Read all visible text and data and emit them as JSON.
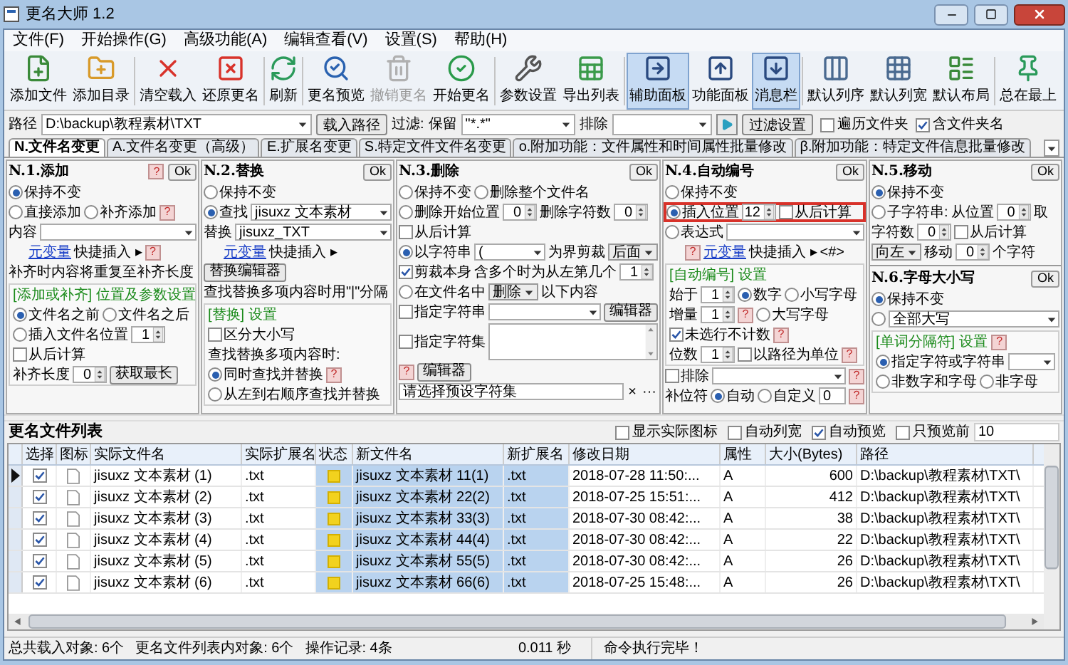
{
  "window": {
    "title": "更名大师 1.2"
  },
  "menu": [
    "文件(F)",
    "开始操作(G)",
    "高级功能(A)",
    "编辑查看(V)",
    "设置(S)",
    "帮助(H)"
  ],
  "toolbar": [
    {
      "label": "添加文件",
      "selected": false,
      "disabled": false
    },
    {
      "label": "添加目录",
      "selected": false,
      "disabled": false
    },
    {
      "label": "清空载入",
      "selected": false,
      "disabled": false
    },
    {
      "label": "还原更名",
      "selected": false,
      "disabled": false
    },
    {
      "label": "刷新",
      "selected": false,
      "disabled": false
    },
    {
      "label": "更名预览",
      "selected": false,
      "disabled": false
    },
    {
      "label": "撤销更名",
      "selected": false,
      "disabled": true
    },
    {
      "label": "开始更名",
      "selected": false,
      "disabled": false
    },
    {
      "label": "参数设置",
      "selected": false,
      "disabled": false
    },
    {
      "label": "导出列表",
      "selected": false,
      "disabled": false
    },
    {
      "label": "辅助面板",
      "selected": true,
      "disabled": false
    },
    {
      "label": "功能面板",
      "selected": false,
      "disabled": false
    },
    {
      "label": "消息栏",
      "selected": true,
      "disabled": false
    },
    {
      "label": "默认列序",
      "selected": false,
      "disabled": false
    },
    {
      "label": "默认列宽",
      "selected": false,
      "disabled": false
    },
    {
      "label": "默认布局",
      "selected": false,
      "disabled": false
    },
    {
      "label": "总在最上",
      "selected": false,
      "disabled": false
    }
  ],
  "path_bar": {
    "label": "路径",
    "value": "D:\\backup\\教程素材\\TXT",
    "load_button": "载入路径",
    "filter_label": "过滤:",
    "keep_label": "保留",
    "keep_value": "\"*.*\"",
    "exclude_label": "排除",
    "filter_settings_button": "过滤设置",
    "options": [
      {
        "label": "遍历文件夹",
        "checked": false
      },
      {
        "label": "含文件夹名",
        "checked": true
      }
    ]
  },
  "tabs": [
    {
      "label": "N.文件名变更",
      "selected": true
    },
    {
      "label": "A.文件名变更（高级）",
      "selected": false
    },
    {
      "label": "E.扩展名变更",
      "selected": false
    },
    {
      "label": "S.特定文件文件名变更",
      "selected": false
    },
    {
      "label": "o.附加功能：文件属性和时间属性批量修改",
      "selected": false
    },
    {
      "label": "β.附加功能：特定文件信息批量修改",
      "selected": false
    }
  ],
  "panel_columns": [
    [
      {
        "title": "N.1.添加",
        "help": "?",
        "ok": "Ok",
        "rows": [
          {
            "items": [
              {
                "kind": "radio",
                "label": "保持不变",
                "selected": true
              }
            ]
          },
          {
            "items": [
              {
                "kind": "radio",
                "label": "直接添加",
                "selected": false
              },
              {
                "kind": "radio",
                "label": "补齐添加",
                "selected": false
              },
              {
                "kind": "help",
                "text": "?"
              }
            ]
          },
          {
            "items": [
              {
                "kind": "text",
                "text": "内容"
              },
              {
                "kind": "dropdown"
              }
            ]
          },
          {
            "items": [
              {
                "kind": "link",
                "text": "元变量"
              },
              {
                "kind": "text",
                "text": "快捷插入 ▸"
              },
              {
                "kind": "help",
                "text": "?"
              }
            ]
          },
          {
            "items": [
              {
                "kind": "text",
                "text": "补齐时内容将重复至补齐长度"
              }
            ]
          },
          {
            "kind": "group",
            "title": "[添加或补齐] 位置及参数设置",
            "rows": [
              {
                "items": [
                  {
                    "kind": "radio",
                    "label": "文件名之前",
                    "selected": true
                  },
                  {
                    "kind": "radio",
                    "label": "文件名之后",
                    "selected": false
                  }
                ]
              },
              {
                "items": [
                  {
                    "kind": "radio",
                    "label": "插入文件名位置",
                    "selected": false
                  },
                  {
                    "kind": "spin",
                    "value": "1"
                  }
                ]
              },
              {
                "items": [
                  {
                    "kind": "checkbox",
                    "label": "从后计算",
                    "checked": false
                  }
                ]
              },
              {
                "items": [
                  {
                    "kind": "text",
                    "text": "补齐长度"
                  },
                  {
                    "kind": "spin",
                    "value": "0"
                  },
                  {
                    "kind": "button",
                    "label": "获取最长"
                  }
                ]
              }
            ]
          }
        ]
      }
    ],
    [
      {
        "title": "N.2.替换",
        "ok": "Ok",
        "rows": [
          {
            "items": [
              {
                "kind": "radio",
                "label": "保持不变",
                "selected": false
              }
            ]
          },
          {
            "items": [
              {
                "kind": "radio",
                "label": "查找",
                "selected": true
              },
              {
                "kind": "dropdown",
                "value": "jisuxz 文本素材"
              }
            ]
          },
          {
            "items": [
              {
                "kind": "text",
                "text": "替换"
              },
              {
                "kind": "dropdown",
                "value": "jisuxz_TXT"
              }
            ]
          },
          {
            "items": [
              {
                "kind": "link",
                "text": "元变量"
              },
              {
                "kind": "text",
                "text": "快捷插入 ▸"
              }
            ]
          },
          {
            "items": [
              {
                "kind": "button",
                "label": "替换编辑器"
              }
            ]
          },
          {
            "items": [
              {
                "kind": "text",
                "text": "查找替换多项内容时用\"|\"分隔"
              }
            ]
          },
          {
            "kind": "group",
            "title": "[替换] 设置",
            "rows": [
              {
                "items": [
                  {
                    "kind": "checkbox",
                    "label": "区分大小写",
                    "checked": false
                  }
                ]
              },
              {
                "items": [
                  {
                    "kind": "text",
                    "text": "查找替换多项内容时:"
                  }
                ]
              },
              {
                "items": [
                  {
                    "kind": "radio",
                    "label": "同时查找并替换",
                    "selected": true
                  },
                  {
                    "kind": "help",
                    "text": "?"
                  }
                ]
              },
              {
                "items": [
                  {
                    "kind": "radio",
                    "label": "从左到右顺序查找并替换",
                    "selected": false
                  }
                ]
              }
            ]
          }
        ]
      }
    ],
    [
      {
        "title": "N.3.删除",
        "ok": "Ok",
        "rows": [
          {
            "items": [
              {
                "kind": "radio",
                "label": "保持不变",
                "selected": false
              },
              {
                "kind": "radio",
                "label": "删除整个文件名",
                "selected": false
              }
            ]
          },
          {
            "items": [
              {
                "kind": "radio",
                "label": "删除开始位置",
                "selected": false
              },
              {
                "kind": "spin",
                "value": "0"
              },
              {
                "kind": "text",
                "text": "删除字符数"
              },
              {
                "kind": "spin",
                "value": "0"
              }
            ]
          },
          {
            "items": [
              {
                "kind": "checkbox",
                "label": "从后计算",
                "checked": false
              }
            ]
          },
          {
            "items": [
              {
                "kind": "radio",
                "label": "以字符串",
                "selected": true
              },
              {
                "kind": "dropdown",
                "value": "("
              },
              {
                "kind": "text",
                "text": "为界剪裁"
              },
              {
                "kind": "select",
                "value": "后面"
              }
            ]
          },
          {
            "items": [
              {
                "kind": "checkbox",
                "label": "剪裁本身",
                "checked": true
              },
              {
                "kind": "text",
                "text": "含多个时为从左第几个"
              },
              {
                "kind": "spin",
                "value": "1"
              }
            ]
          },
          {
            "items": [
              {
                "kind": "radio",
                "label": "在文件名中",
                "selected": false
              },
              {
                "kind": "select",
                "value": "删除"
              },
              {
                "kind": "text",
                "text": "以下内容"
              }
            ]
          },
          {
            "items": [
              {
                "kind": "checkbox",
                "label": "指定字符串",
                "checked": false
              },
              {
                "kind": "dropdown"
              },
              {
                "kind": "button",
                "label": "编辑器"
              }
            ]
          },
          {
            "items": [
              {
                "kind": "checkbox",
                "label": "指定字符集",
                "checked": false
              },
              {
                "kind": "textarea"
              }
            ]
          },
          {
            "items": [
              {
                "kind": "help",
                "text": "?"
              },
              {
                "kind": "button",
                "label": "编辑器"
              }
            ]
          },
          {
            "items": [
              {
                "kind": "input",
                "value": "请选择预设字符集"
              },
              {
                "kind": "glyph",
                "text": "×"
              },
              {
                "kind": "glyph",
                "text": "···"
              }
            ]
          }
        ]
      }
    ],
    [
      {
        "title": "N.4.自动编号",
        "ok": "Ok",
        "rows": [
          {
            "items": [
              {
                "kind": "radio",
                "label": "保持不变",
                "selected": false
              }
            ]
          },
          {
            "highlight": true,
            "items": [
              {
                "kind": "radio",
                "label": "插入位置",
                "selected": true
              },
              {
                "kind": "spin",
                "value": "12"
              },
              {
                "kind": "checkbox",
                "label": "从后计算",
                "checked": false
              }
            ]
          },
          {
            "items": [
              {
                "kind": "radio",
                "label": "表达式",
                "selected": false
              },
              {
                "kind": "dropdown"
              }
            ]
          },
          {
            "items": [
              {
                "kind": "help",
                "text": "?"
              },
              {
                "kind": "link",
                "text": "元变量"
              },
              {
                "kind": "text",
                "text": "快捷插入 ▸"
              },
              {
                "kind": "text",
                "text": "<#>"
              }
            ]
          },
          {
            "kind": "group",
            "title": "[自动编号] 设置",
            "rows": [
              {
                "items": [
                  {
                    "kind": "text",
                    "text": "始于"
                  },
                  {
                    "kind": "spin",
                    "value": "1"
                  },
                  {
                    "kind": "radio",
                    "label": "数字",
                    "selected": true
                  },
                  {
                    "kind": "radio",
                    "label": "小写字母",
                    "selected": false
                  }
                ]
              },
              {
                "items": [
                  {
                    "kind": "text",
                    "text": "增量"
                  },
                  {
                    "kind": "spin",
                    "value": "1"
                  },
                  {
                    "kind": "help",
                    "text": "?"
                  },
                  {
                    "kind": "radio",
                    "label": "大写字母",
                    "selected": false
                  }
                ]
              },
              {
                "items": [
                  {
                    "kind": "checkbox",
                    "label": "未选行不计数",
                    "checked": true
                  },
                  {
                    "kind": "help",
                    "text": "?"
                  }
                ]
              },
              {
                "items": [
                  {
                    "kind": "text",
                    "text": "位数"
                  },
                  {
                    "kind": "spin",
                    "value": "1"
                  },
                  {
                    "kind": "checkbox",
                    "label": "以路径为单位",
                    "checked": false
                  },
                  {
                    "kind": "help",
                    "text": "?"
                  }
                ]
              }
            ]
          },
          {
            "items": [
              {
                "kind": "checkbox",
                "label": "排除",
                "checked": false
              },
              {
                "kind": "dropdown"
              },
              {
                "kind": "help",
                "text": "?"
              }
            ]
          },
          {
            "items": [
              {
                "kind": "text",
                "text": "补位符"
              },
              {
                "kind": "radio",
                "label": "自动",
                "selected": true
              },
              {
                "kind": "radio",
                "label": "自定义",
                "selected": false
              },
              {
                "kind": "input",
                "value": "0"
              },
              {
                "kind": "help",
                "text": "?"
              }
            ]
          }
        ]
      }
    ],
    [
      {
        "title": "N.5.移动",
        "ok": "Ok",
        "rows": [
          {
            "items": [
              {
                "kind": "radio",
                "label": "保持不变",
                "selected": true
              }
            ]
          },
          {
            "items": [
              {
                "kind": "radio",
                "label": "子字符串:",
                "selected": false
              },
              {
                "kind": "text",
                "text": "从位置"
              },
              {
                "kind": "spin",
                "value": "0"
              },
              {
                "kind": "text",
                "text": "取"
              }
            ]
          },
          {
            "items": [
              {
                "kind": "text",
                "text": "字符数"
              },
              {
                "kind": "spin",
                "value": "0"
              },
              {
                "kind": "checkbox",
                "label": "从后计算",
                "checked": false
              }
            ]
          },
          {
            "items": [
              {
                "kind": "select",
                "value": "向左"
              },
              {
                "kind": "text",
                "text": "移动"
              },
              {
                "kind": "spin",
                "value": "0"
              },
              {
                "kind": "text",
                "text": "个字符"
              }
            ]
          }
        ]
      },
      {
        "title": "N.6.字母大小写",
        "ok": "Ok",
        "rows": [
          {
            "items": [
              {
                "kind": "radio",
                "label": "保持不变",
                "selected": true
              }
            ]
          },
          {
            "items": [
              {
                "kind": "radio",
                "selected": false
              },
              {
                "kind": "dropdown",
                "value": "全部大写"
              }
            ]
          },
          {
            "kind": "group",
            "title": "[单词分隔符] 设置",
            "help": "?",
            "rows": [
              {
                "items": [
                  {
                    "kind": "radio",
                    "label": "指定字符或字符串",
                    "selected": true
                  },
                  {
                    "kind": "dropdown"
                  }
                ]
              },
              {
                "items": [
                  {
                    "kind": "radio",
                    "label": "非数字和字母",
                    "selected": false
                  },
                  {
                    "kind": "radio",
                    "label": "非字母",
                    "selected": false
                  }
                ]
              }
            ]
          }
        ]
      }
    ]
  ],
  "file_list": {
    "title": "更名文件列表",
    "options": [
      {
        "label": "显示实际图标",
        "checked": false
      },
      {
        "label": "自动列宽",
        "checked": false
      },
      {
        "label": "自动预览",
        "checked": true
      },
      {
        "label": "只预览前",
        "checked": false
      }
    ],
    "preview_count": "10",
    "columns": [
      "选择",
      "图标",
      "实际文件名",
      "实际扩展名",
      "状态",
      "新文件名",
      "新扩展名",
      "修改日期",
      "属性",
      "大小(Bytes)",
      "路径"
    ],
    "rows": [
      {
        "current": true,
        "checked": true,
        "name": "jisuxz 文本素材 (1)",
        "ext": ".txt",
        "new_name": "jisuxz 文本素材 11(1)",
        "new_ext": ".txt",
        "modified": "2018-07-28 11:50:...",
        "attributes": "A",
        "size": "600",
        "path": "D:\\backup\\教程素材\\TXT\\"
      },
      {
        "current": false,
        "checked": true,
        "name": "jisuxz 文本素材 (2)",
        "ext": ".txt",
        "new_name": "jisuxz 文本素材 22(2)",
        "new_ext": ".txt",
        "modified": "2018-07-25 15:51:...",
        "attributes": "A",
        "size": "412",
        "path": "D:\\backup\\教程素材\\TXT\\"
      },
      {
        "current": false,
        "checked": true,
        "name": "jisuxz 文本素材 (3)",
        "ext": ".txt",
        "new_name": "jisuxz 文本素材 33(3)",
        "new_ext": ".txt",
        "modified": "2018-07-30 08:42:...",
        "attributes": "A",
        "size": "38",
        "path": "D:\\backup\\教程素材\\TXT\\"
      },
      {
        "current": false,
        "checked": true,
        "name": "jisuxz 文本素材 (4)",
        "ext": ".txt",
        "new_name": "jisuxz 文本素材 44(4)",
        "new_ext": ".txt",
        "modified": "2018-07-30 08:42:...",
        "attributes": "A",
        "size": "22",
        "path": "D:\\backup\\教程素材\\TXT\\"
      },
      {
        "current": false,
        "checked": true,
        "name": "jisuxz 文本素材 (5)",
        "ext": ".txt",
        "new_name": "jisuxz 文本素材 55(5)",
        "new_ext": ".txt",
        "modified": "2018-07-30 08:42:...",
        "attributes": "A",
        "size": "26",
        "path": "D:\\backup\\教程素材\\TXT\\"
      },
      {
        "current": false,
        "checked": true,
        "name": "jisuxz 文本素材 (6)",
        "ext": ".txt",
        "new_name": "jisuxz 文本素材 66(6)",
        "new_ext": ".txt",
        "modified": "2018-07-25 15:48:...",
        "attributes": "A",
        "size": "26",
        "path": "D:\\backup\\教程素材\\TXT\\"
      }
    ]
  },
  "status_bar": {
    "items": [
      "总共载入对象: 6个",
      "更名文件列表内对象: 6个",
      "操作记录: 4条"
    ],
    "time": "0.011 秒",
    "message": "命令执行完毕！"
  }
}
